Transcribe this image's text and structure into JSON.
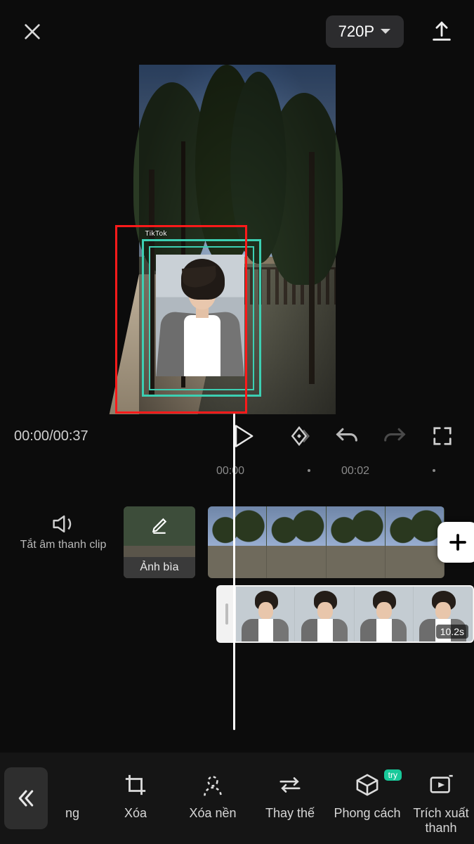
{
  "topbar": {
    "resolution_label": "720P"
  },
  "playback": {
    "current_time": "00:00",
    "total_time": "00:37"
  },
  "preview": {
    "watermark": "TikTok"
  },
  "ruler": {
    "marks": [
      "00:00",
      "00:02"
    ]
  },
  "tracks": {
    "mute_label": "Tắt âm thanh clip",
    "cover_label": "Ảnh bìa",
    "overlay_clip_duration": "10.2s"
  },
  "toolbar": {
    "partial_first": "ng",
    "items": [
      {
        "id": "xoa",
        "label": "Xóa"
      },
      {
        "id": "xoa-nen",
        "label": "Xóa nền"
      },
      {
        "id": "thay-the",
        "label": "Thay thế"
      },
      {
        "id": "phong-cach",
        "label": "Phong cách",
        "badge": "try"
      },
      {
        "id": "trich-xuat",
        "label": "Trích xuất\nthanh"
      }
    ]
  }
}
